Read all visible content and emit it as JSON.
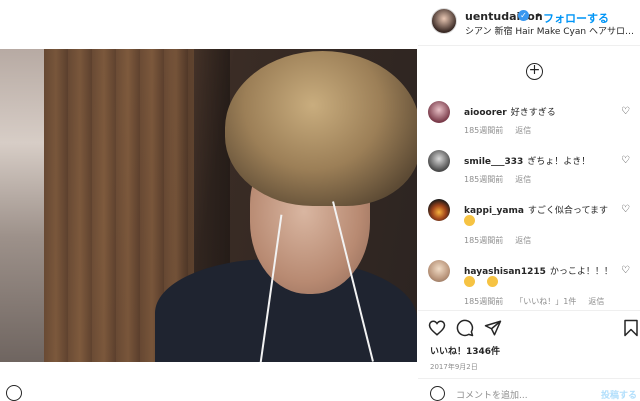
{
  "header": {
    "username": "uentudaikon",
    "dot": "•",
    "follow_label": "フォローする",
    "subtitle": "シアン 新宿 Hair Make Cyan ヘアサロン 美容..."
  },
  "comments": [
    {
      "user": "aiooorer",
      "text": "好きすぎる",
      "time": "185週間前",
      "reply": "返信",
      "extra": ""
    },
    {
      "user": "smile___333",
      "text": "ぎちょ！よき！",
      "time": "185週間前",
      "reply": "返信",
      "extra": ""
    },
    {
      "user": "kappi_yama",
      "text": "すごく似合ってます",
      "time": "185週間前",
      "reply": "返信",
      "extra": ""
    },
    {
      "user": "hayashisan1215",
      "text": "かっこよ！！！",
      "time": "185週間前",
      "reply": "返信",
      "extra": "「いいね！」1件"
    }
  ],
  "likes": "いいね！1346件",
  "date": "2017年9月2日",
  "comment_placeholder": "コメントを追加...",
  "post_label": "投稿する",
  "icons": {
    "add": "plus-circle-icon",
    "heart": "heart-icon",
    "comment": "comment-icon",
    "share": "share-icon",
    "save": "bookmark-icon",
    "emoji": "smile-icon"
  },
  "colors": {
    "follow": "#0095f6",
    "post_disabled": "#b2dffc",
    "verified": "#3897f0"
  }
}
